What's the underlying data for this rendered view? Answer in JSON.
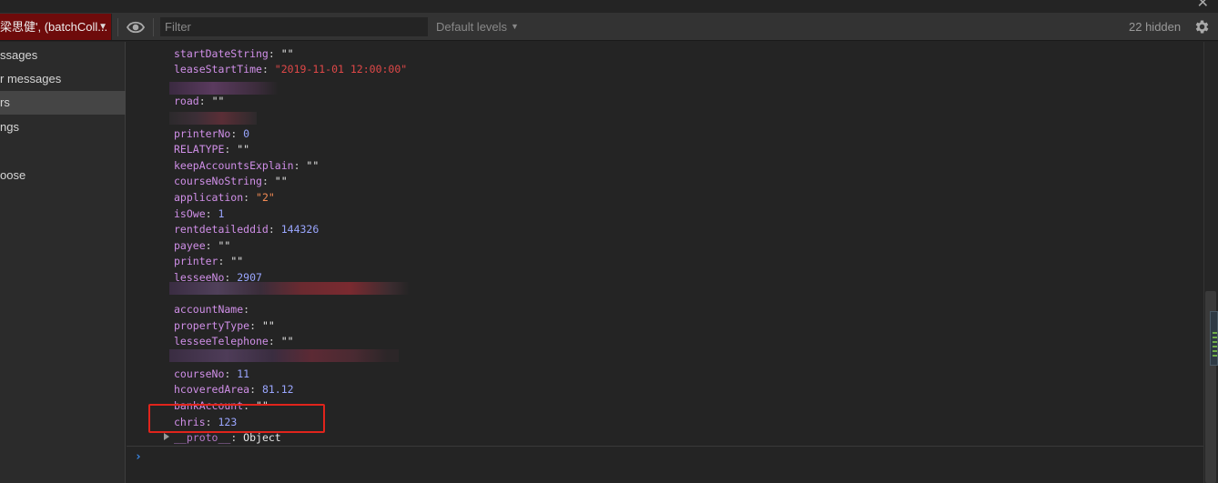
{
  "window": {
    "close_label": "✕"
  },
  "toolbar": {
    "context": "梁思健', (batchColl...",
    "filter_placeholder": "Filter",
    "levels": "Default levels",
    "hidden": "22 hidden",
    "icons": {
      "eye": "eye-icon",
      "gear": "gear-icon",
      "dropdown": "chevron-down-icon"
    }
  },
  "sidebar": {
    "items": [
      {
        "label": "ssages"
      },
      {
        "label": "r messages"
      },
      {
        "label": "rs",
        "selected": true
      },
      {
        "label": "ngs"
      },
      {
        "label": ""
      },
      {
        "label": "oose"
      }
    ]
  },
  "console": {
    "entries": [
      {
        "key": "startDateString",
        "value": "\"\"",
        "type": "string"
      },
      {
        "key": "leaseStartTime",
        "value": "\"2019-11-01 12:00:00\"",
        "type": "string-red"
      },
      {
        "key": "road",
        "value": "\"\"",
        "type": "string"
      },
      {
        "key": "printerNo",
        "value": "0",
        "type": "number"
      },
      {
        "key": "RELATYPE",
        "value": "\"\"",
        "type": "string"
      },
      {
        "key": "keepAccountsExplain",
        "value": "\"\"",
        "type": "string"
      },
      {
        "key": "courseNoString",
        "value": "\"\"",
        "type": "string"
      },
      {
        "key": "application",
        "value": "\"2\"",
        "type": "string"
      },
      {
        "key": "isOwe",
        "value": "1",
        "type": "number"
      },
      {
        "key": "rentdetaileddid",
        "value": "144326",
        "type": "number"
      },
      {
        "key": "payee",
        "value": "\"\"",
        "type": "string"
      },
      {
        "key": "printer",
        "value": "\"\"",
        "type": "string"
      },
      {
        "key": "lesseeNo",
        "value": "2907",
        "type": "number"
      },
      {
        "key": "accountName",
        "value": "",
        "type": "string"
      },
      {
        "key": "propertyType",
        "value": "\"\"",
        "type": "string"
      },
      {
        "key": "lesseeTelephone",
        "value": "\"\"",
        "type": "string"
      },
      {
        "key": "courseNo",
        "value": "11",
        "type": "number"
      },
      {
        "key": "hcoveredArea",
        "value": "81.12",
        "type": "number"
      },
      {
        "key": "bankAccount",
        "value": "\"\"",
        "type": "string"
      },
      {
        "key": "chris",
        "value": "123",
        "type": "number"
      }
    ],
    "proto": {
      "key": "__proto__",
      "value": "Object"
    },
    "prompt": "›"
  },
  "colors": {
    "context_bg": "#6e0b0b",
    "highlight": "#e0241c",
    "key": "#d08fe8",
    "number": "#9aa6ff",
    "string": "#f28b54"
  }
}
